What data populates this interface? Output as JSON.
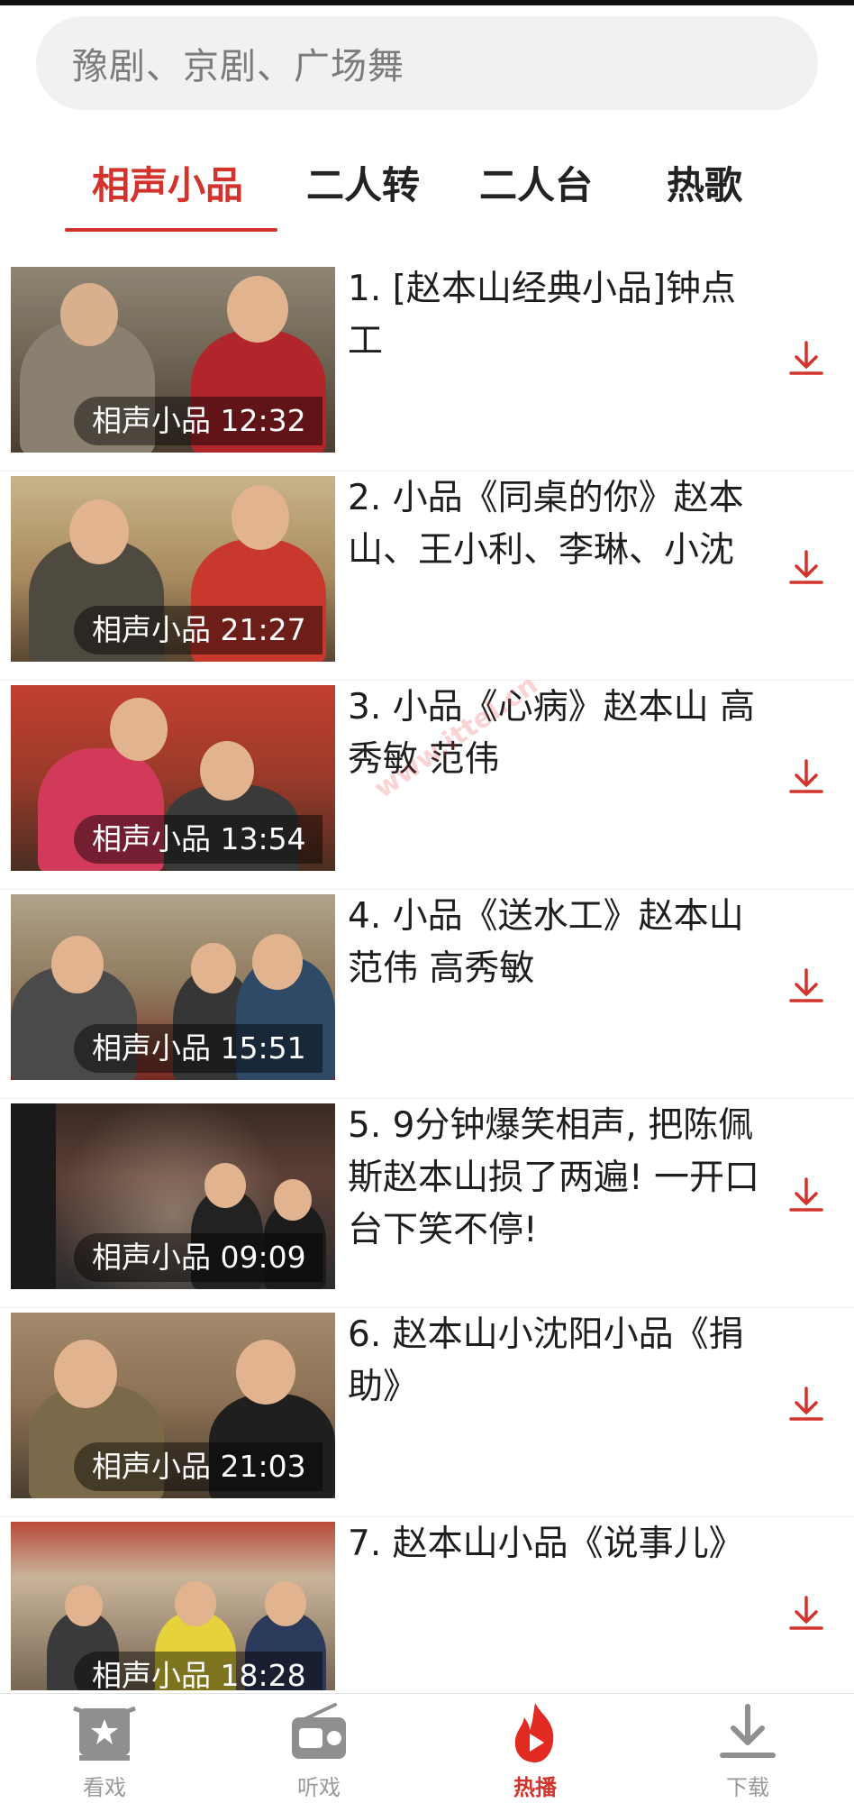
{
  "search": {
    "placeholder": "豫剧、京剧、广场舞"
  },
  "tabs": [
    {
      "label": "相声小品",
      "active": true
    },
    {
      "label": "二人转",
      "active": false
    },
    {
      "label": "二人台",
      "active": false
    },
    {
      "label": "热歌",
      "active": false
    }
  ],
  "items": [
    {
      "title": "1. [赵本山经典小品]钟点工",
      "badge": "相声小品 12:32"
    },
    {
      "title": "2. 小品《同桌的你》赵本山、王小利、李琳、小沈",
      "badge": "相声小品 21:27"
    },
    {
      "title": "3. 小品《心病》赵本山 高秀敏 范伟",
      "badge": "相声小品 13:54"
    },
    {
      "title": "4. 小品《送水工》赵本山 范伟 高秀敏",
      "badge": "相声小品 15:51"
    },
    {
      "title": "5. 9分钟爆笑相声, 把陈佩斯赵本山损了两遍! 一开口台下笑不停!",
      "badge": "相声小品 09:09"
    },
    {
      "title": "6. 赵本山小沈阳小品《捐助》",
      "badge": "相声小品 21:03"
    },
    {
      "title": "7. 赵本山小品《说事儿》",
      "badge": "相声小品 18:28"
    }
  ],
  "nav": {
    "items": [
      {
        "label": "看戏",
        "icon": "theater-icon",
        "active": false
      },
      {
        "label": "听戏",
        "icon": "radio-icon",
        "active": false
      },
      {
        "label": "热播",
        "icon": "flame-play-icon",
        "active": true
      },
      {
        "label": "下载",
        "icon": "download-icon",
        "active": false
      }
    ]
  },
  "watermark": "www.ittel.cn",
  "colors": {
    "accent": "#d4322c",
    "text": "#1e1e1e",
    "muted": "#9a9a9a",
    "search_bg": "#f1f1f1"
  }
}
